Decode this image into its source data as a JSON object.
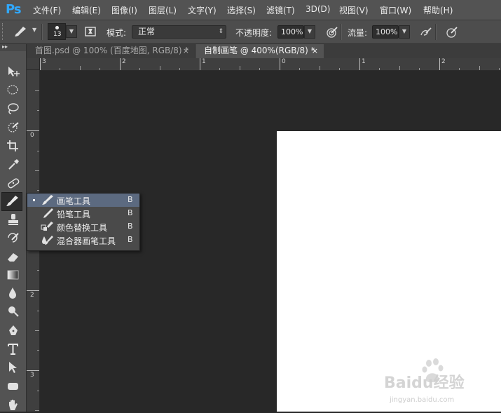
{
  "app": {
    "logo": "Ps"
  },
  "menu": {
    "items": [
      "文件(F)",
      "编辑(E)",
      "图像(I)",
      "图层(L)",
      "文字(Y)",
      "选择(S)",
      "滤镜(T)",
      "3D(D)",
      "视图(V)",
      "窗口(W)",
      "帮助(H)"
    ]
  },
  "options": {
    "brush_size": "13",
    "mode_label": "模式:",
    "mode_value": "正常",
    "opacity_label": "不透明度:",
    "opacity_value": "100%",
    "flow_label": "流量:",
    "flow_value": "100%"
  },
  "tabs": [
    {
      "label": "首图.psd @ 100% (百度地图, RGB/8) *",
      "close": "×",
      "active": false
    },
    {
      "label": "自制画笔 @ 400%(RGB/8) *",
      "close": "×",
      "active": true
    }
  ],
  "ruler": {
    "horizontal": [
      "3",
      "2",
      "1",
      "0",
      "1",
      "2"
    ],
    "vertical": [
      "0",
      "1",
      "2",
      "3"
    ]
  },
  "flyout": {
    "items": [
      {
        "label": "画笔工具",
        "key": "B",
        "selected": true,
        "icon": "brush-icon"
      },
      {
        "label": "铅笔工具",
        "key": "B",
        "selected": false,
        "icon": "pencil-icon"
      },
      {
        "label": "颜色替换工具",
        "key": "B",
        "selected": false,
        "icon": "color-replacement-icon"
      },
      {
        "label": "混合器画笔工具",
        "key": "B",
        "selected": false,
        "icon": "mixer-brush-icon"
      }
    ]
  },
  "watermark": {
    "brand": "Baidu经验",
    "url": "jingyan.baidu.com"
  },
  "colors": {
    "accent": "#31a8ff",
    "selection": "#5c6a80",
    "canvas": "#282828",
    "document": "#ffffff"
  }
}
